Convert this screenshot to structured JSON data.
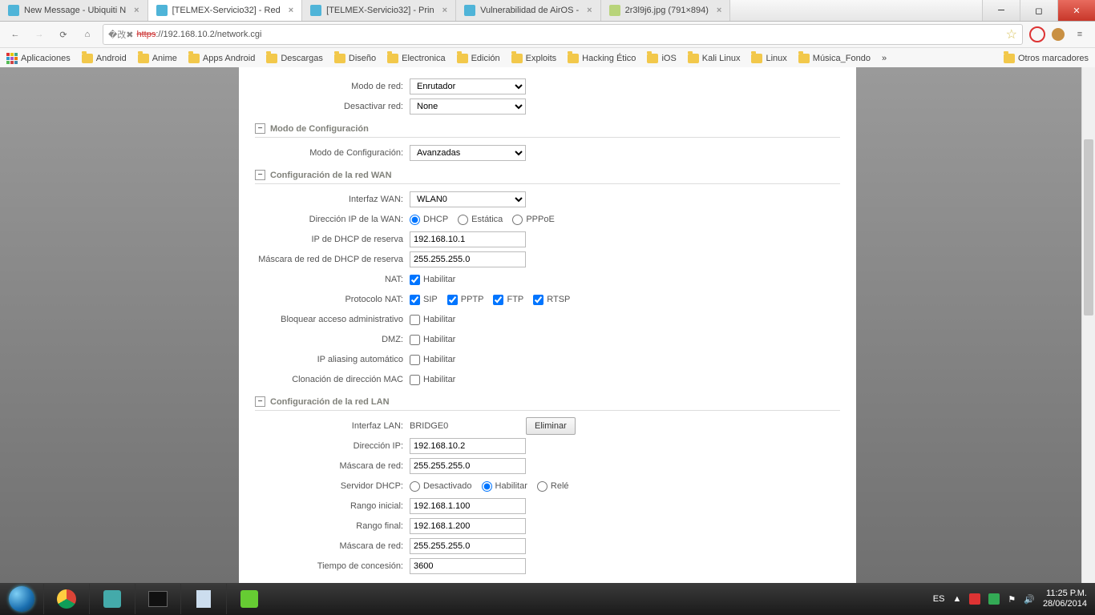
{
  "tabs": [
    {
      "title": "New Message - Ubiquiti N",
      "fav": "#4fb4d8"
    },
    {
      "title": "[TELMEX-Servicio32] - Red",
      "fav": "#4fb4d8",
      "active": true
    },
    {
      "title": "[TELMEX-Servicio32] - Prin",
      "fav": "#4fb4d8"
    },
    {
      "title": "Vulnerabilidad de AirOS -",
      "fav": "#4fb4d8"
    },
    {
      "title": "2r3l9j6.jpg (791×894)",
      "fav": "#b8d47a"
    }
  ],
  "url": {
    "scheme_strike": "https",
    "rest": "://192.168.10.2/network.cgi"
  },
  "bookmarks": {
    "apps": "Aplicaciones",
    "items": [
      "Android",
      "Anime",
      "Apps Android",
      "Descargas",
      "Diseño",
      "Electronica",
      "Edición",
      "Exploits",
      "Hacking Ético",
      "iOS",
      "Kali Linux",
      "Linux",
      "Música_Fondo"
    ],
    "more": "»",
    "other": "Otros marcadores"
  },
  "top": {
    "modo_red": {
      "label": "Modo de red:",
      "value": "Enrutador"
    },
    "desactivar": {
      "label": "Desactivar red:",
      "value": "None"
    }
  },
  "sec_cfg": {
    "title": "Modo de Configuración",
    "modo": {
      "label": "Modo de Configuración:",
      "value": "Avanzadas"
    }
  },
  "sec_wan": {
    "title": "Configuración de la red WAN",
    "interfaz": {
      "label": "Interfaz WAN:",
      "value": "WLAN0"
    },
    "direccion": {
      "label": "Dirección IP de la WAN:",
      "opts": [
        "DHCP",
        "Estática",
        "PPPoE"
      ],
      "selected": "DHCP"
    },
    "ip_reserva": {
      "label": "IP de DHCP de reserva",
      "value": "192.168.10.1"
    },
    "mask_reserva": {
      "label": "Máscara de red de DHCP de reserva",
      "value": "255.255.255.0"
    },
    "nat": {
      "label": "NAT:",
      "text": "Habilitar",
      "checked": true
    },
    "proto": {
      "label": "Protocolo NAT:",
      "items": [
        {
          "t": "SIP",
          "c": true
        },
        {
          "t": "PPTP",
          "c": true
        },
        {
          "t": "FTP",
          "c": true
        },
        {
          "t": "RTSP",
          "c": true
        }
      ]
    },
    "block_admin": {
      "label": "Bloquear acceso administrativo",
      "text": "Habilitar",
      "checked": false
    },
    "dmz": {
      "label": "DMZ:",
      "text": "Habilitar",
      "checked": false
    },
    "ip_alias": {
      "label": "IP aliasing automático",
      "text": "Habilitar",
      "checked": false
    },
    "mac_clone": {
      "label": "Clonación de dirección MAC",
      "text": "Habilitar",
      "checked": false
    }
  },
  "sec_lan": {
    "title": "Configuración de la red LAN",
    "interfaz": {
      "label": "Interfaz LAN:",
      "value": "BRIDGE0",
      "btn": "Eliminar"
    },
    "ip": {
      "label": "Dirección IP:",
      "value": "192.168.10.2"
    },
    "mask": {
      "label": "Máscara de red:",
      "value": "255.255.255.0"
    },
    "dhcp": {
      "label": "Servidor DHCP:",
      "opts": [
        "Desactivado",
        "Habilitar",
        "Relé"
      ],
      "selected": "Habilitar"
    },
    "range_start": {
      "label": "Rango inicial:",
      "value": "192.168.1.100"
    },
    "range_end": {
      "label": "Rango final:",
      "value": "192.168.1.200"
    },
    "mask2": {
      "label": "Máscara de red:",
      "value": "255.255.255.0"
    },
    "lease": {
      "label": "Tiempo de concesión:",
      "value": "3600"
    }
  },
  "tray": {
    "lang": "ES",
    "time": "11:25 P.M.",
    "date": "28/06/2014"
  }
}
